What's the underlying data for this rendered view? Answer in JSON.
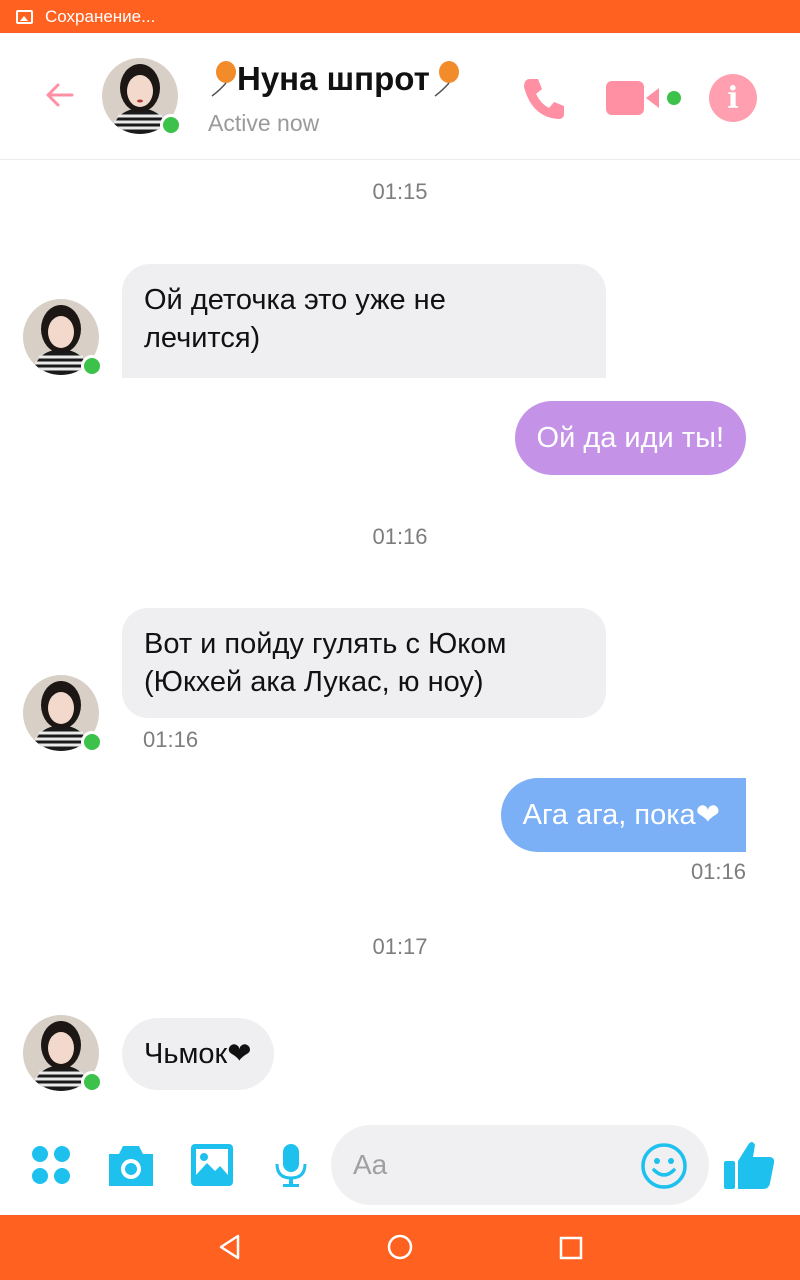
{
  "status_bar": {
    "text": "Сохранение...",
    "icon": "image-icon"
  },
  "header": {
    "title": "Нуна шпрот",
    "title_decor": "balloon-icon",
    "subtitle": "Active now",
    "icons": [
      "back-arrow-icon",
      "phone-icon",
      "video-camera-icon",
      "info-icon"
    ],
    "accent_color": "#ff8fa3"
  },
  "messages": [
    {
      "type": "timestamp",
      "text": "01:15"
    },
    {
      "type": "incoming",
      "text_lines": [
        "Ой деточка это уже не",
        "лечится)"
      ]
    },
    {
      "type": "outgoing",
      "text": "Ой да иди ты!",
      "color": "#c493e8"
    },
    {
      "type": "timestamp",
      "text": "01:16"
    },
    {
      "type": "incoming",
      "text_lines": [
        "Вот и пойду гулять с Юком",
        "(Юкхей ака Лукас, ю ноу)"
      ],
      "time": "01:16"
    },
    {
      "type": "outgoing",
      "text": "Ага ага, пока❤",
      "color": "#7baff6",
      "time": "01:16"
    },
    {
      "type": "timestamp",
      "text": "01:17"
    },
    {
      "type": "incoming",
      "text": "Чьмок❤"
    }
  ],
  "composer": {
    "placeholder": "Aa",
    "icons": [
      "apps-icon",
      "camera-icon",
      "gallery-icon",
      "microphone-icon",
      "emoji-icon",
      "thumbs-up-icon"
    ],
    "icon_color": "#1ec0ee"
  },
  "nav_bar": {
    "icons": [
      "back-triangle-icon",
      "home-circle-icon",
      "recents-square-icon"
    ]
  },
  "colors": {
    "system_bar": "#ff6120",
    "online": "#3cc14a",
    "incoming_bubble": "#efeef1"
  }
}
